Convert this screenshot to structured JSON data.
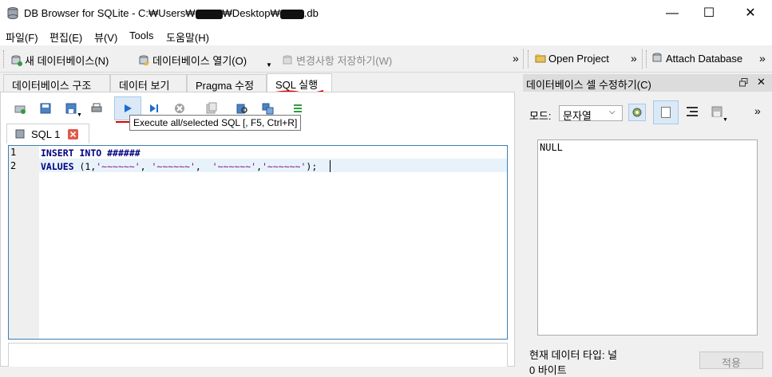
{
  "window": {
    "title_prefix": "DB Browser for SQLite - C:₩Users₩",
    "title_mid": "₩Desktop₩",
    "title_suffix": ".db",
    "minimize": "—",
    "maximize": "☐",
    "close": "✕"
  },
  "menu": [
    "파일(F)",
    "편집(E)",
    "뷰(V)",
    "Tools",
    "도움말(H)"
  ],
  "toolbar": {
    "new_db": "새 데이터베이스(N)",
    "open_db": "데이터베이스 열기(O)",
    "write_changes": "변경사항 저장하기(W)",
    "open_project": "Open Project",
    "attach_db": "Attach Database",
    "overflow": "»"
  },
  "tabs": [
    "데이터베이스 구조",
    "데이터 보기",
    "Pragma 수정",
    "SQL 실행"
  ],
  "sql": {
    "tooltip": "Execute all/selected SQL [, F5, Ctrl+R]",
    "subtab_label": "SQL 1",
    "line_numbers": [
      "1",
      "2"
    ],
    "line1_kw1": "INSERT",
    "line1_kw2": "INTO",
    "line1_rest": "######",
    "line2_kw": "VALUES",
    "line2_open": " (1,",
    "line2_s1": "'~~~~~~'",
    "line2_c1": ", ",
    "line2_s2": "'~~~~~~'",
    "line2_c2": ",  ",
    "line2_s3": "'~~~~~~'",
    "line2_c3": ",",
    "line2_s4": "'~~~~~~'",
    "line2_close": ");"
  },
  "edit_cell": {
    "title": "데이터베이스 셀 수정하기(C)",
    "mode_label": "모드:",
    "mode_value": "문자열",
    "cell_value": "NULL",
    "type_text": "현재 데이터 타입: 널",
    "size_text": "0 바이트",
    "apply_label": "적용",
    "overflow": "»"
  },
  "colors": {
    "accent": "#0078d7",
    "editor_border": "#3c7fb1",
    "annotation_red": "#e00000"
  }
}
